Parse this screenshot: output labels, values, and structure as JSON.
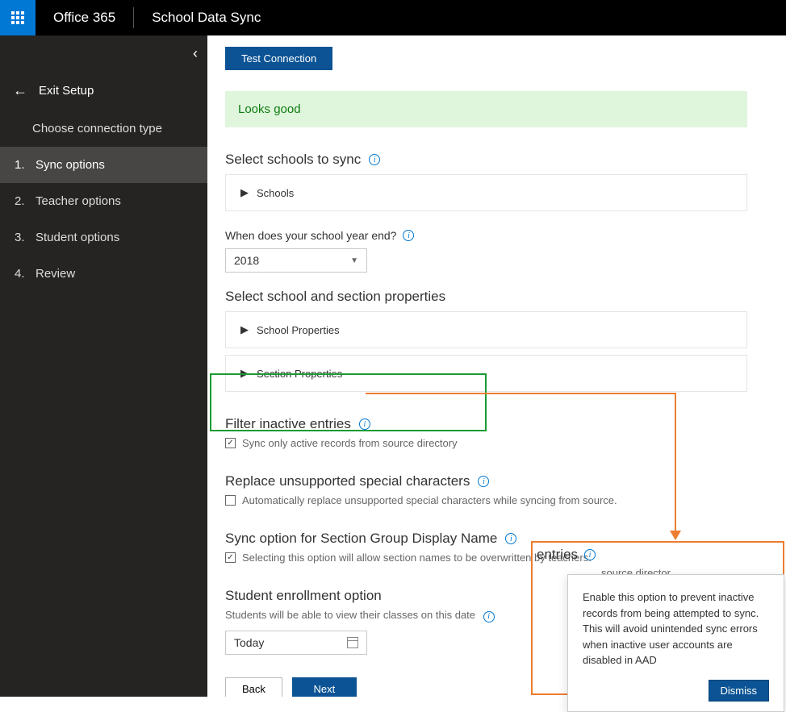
{
  "header": {
    "suite": "Office 365",
    "app": "School Data Sync"
  },
  "sidebar": {
    "exit": "Exit Setup",
    "choose_connection": "Choose connection type",
    "steps": [
      {
        "num": "1.",
        "label": "Sync options"
      },
      {
        "num": "2.",
        "label": "Teacher options"
      },
      {
        "num": "3.",
        "label": "Student options"
      },
      {
        "num": "4.",
        "label": "Review"
      }
    ]
  },
  "main": {
    "test_connection": "Test Connection",
    "alert": "Looks good",
    "select_schools_heading": "Select schools to sync",
    "schools_panel": "Schools",
    "year_end_label": "When does your school year end?",
    "year_end_value": "2018",
    "properties_heading": "Select school and section properties",
    "school_props": "School Properties",
    "section_props": "Section Properties",
    "filter_heading": "Filter inactive entries",
    "filter_checkbox": "Sync only active records from source directory",
    "replace_heading": "Replace unsupported special characters",
    "replace_checkbox": "Automatically replace unsupported special characters while syncing from source.",
    "sync_option_heading": "Sync option for Section Group Display Name",
    "sync_option_checkbox": "Selecting this option will allow section names to be overwritten by teachers.",
    "enrollment_heading": "Student enrollment option",
    "enrollment_text": "Students will be able to view their classes on this date",
    "date_value": "Today",
    "back": "Back",
    "next": "Next"
  },
  "tooltip": {
    "heading_fragment": "entries",
    "cutoff_text": "source director",
    "body": "Enable this option to prevent inactive records from being attempted to sync. This will avoid unintended sync errors when inactive user accounts are disabled in AAD",
    "dismiss": "Dismiss"
  }
}
